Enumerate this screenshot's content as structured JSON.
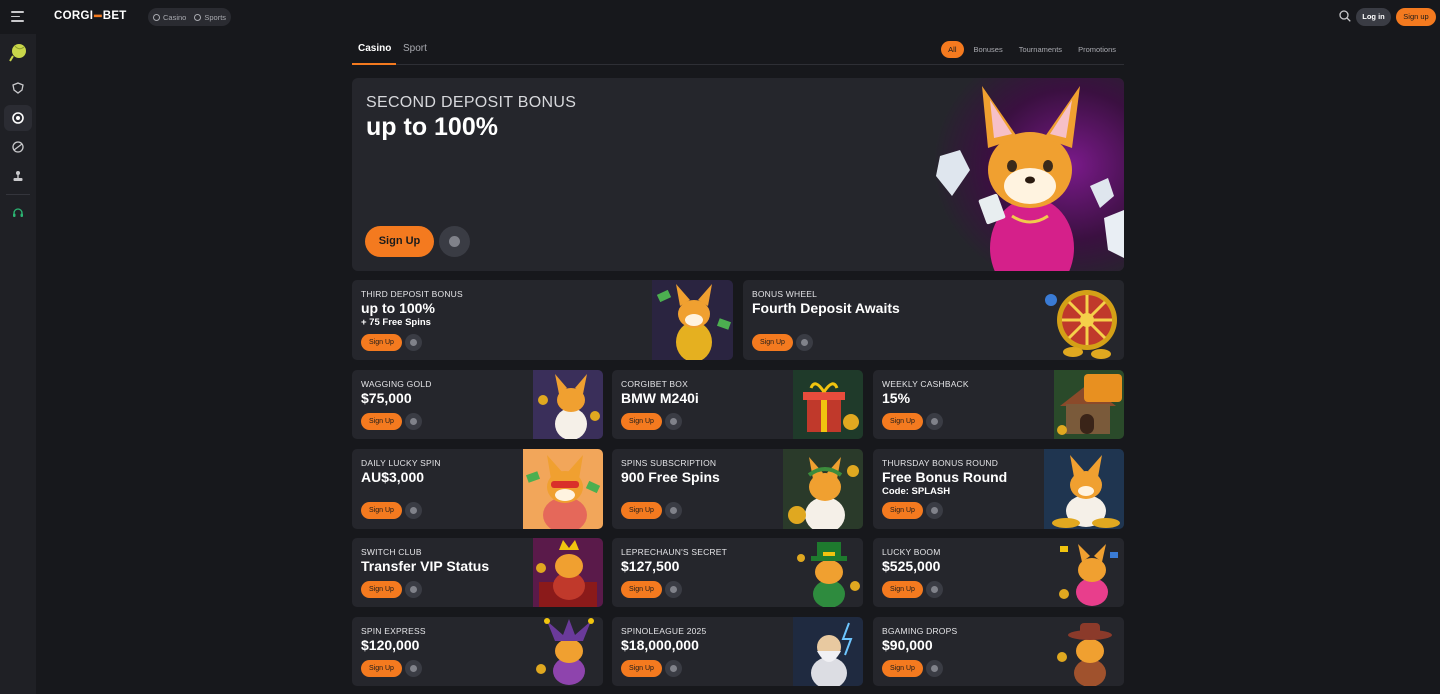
{
  "header": {
    "logo_left": "CORGI",
    "logo_right": "BET",
    "switcher": [
      "Casino",
      "Sports"
    ],
    "login_label": "Log in",
    "signup_label": "Sign up"
  },
  "tabs": [
    "Casino",
    "Sport"
  ],
  "filters": [
    "All",
    "Bonuses",
    "Tournaments",
    "Promotions"
  ],
  "colors": {
    "accent": "#f47a1f",
    "background": "#17181c",
    "card": "#25262c"
  },
  "hero": {
    "subtitle": "SECOND DEPOSIT BONUS",
    "title": "up to 100%",
    "button": "Sign Up"
  },
  "wide_promos": [
    {
      "label": "THIRD DEPOSIT BONUS",
      "title": "up to 100%",
      "subtitle": "+ 75 Free Spins",
      "button": "Sign Up"
    },
    {
      "label": "BONUS WHEEL",
      "title": "Fourth Deposit Awaits",
      "subtitle": "",
      "button": "Sign Up"
    }
  ],
  "promos": [
    {
      "label": "WAGGING GOLD",
      "title": "$75,000",
      "subtitle": "",
      "button": "Sign Up"
    },
    {
      "label": "CORGIBET BOX",
      "title": "BMW M240i",
      "subtitle": "",
      "button": "Sign Up"
    },
    {
      "label": "WEEKLY CASHBACK",
      "title": "15%",
      "subtitle": "",
      "button": "Sign Up"
    },
    {
      "label": "DAILY LUCKY SPIN",
      "title": "AU$3,000",
      "subtitle": "",
      "button": "Sign Up"
    },
    {
      "label": "SPINS SUBSCRIPTION",
      "title": "900 Free Spins",
      "subtitle": "",
      "button": "Sign Up"
    },
    {
      "label": "THURSDAY BONUS ROUND",
      "title": "Free Bonus Round",
      "subtitle": "Code: SPLASH",
      "button": "Sign Up"
    },
    {
      "label": "SWITCH CLUB",
      "title": "Transfer VIP Status",
      "subtitle": "",
      "button": "Sign Up"
    },
    {
      "label": "LEPRECHAUN'S SECRET",
      "title": "$127,500",
      "subtitle": "",
      "button": "Sign Up"
    },
    {
      "label": "LUCKY BOOM",
      "title": "$525,000",
      "subtitle": "",
      "button": "Sign Up"
    },
    {
      "label": "SPIN EXPRESS",
      "title": "$120,000",
      "subtitle": "",
      "button": "Sign Up"
    },
    {
      "label": "SPINOLEAGUE 2025",
      "title": "$18,000,000",
      "subtitle": "",
      "button": "Sign Up"
    },
    {
      "label": "BGAMING DROPS",
      "title": "$90,000",
      "subtitle": "",
      "button": "Sign Up"
    }
  ]
}
